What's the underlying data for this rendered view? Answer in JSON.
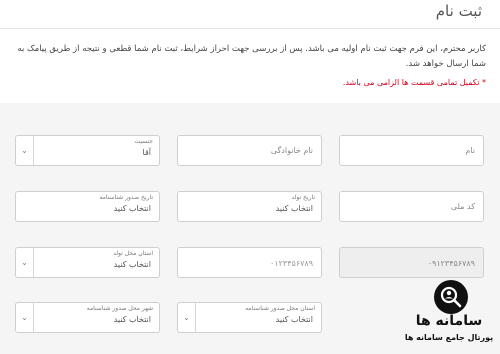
{
  "page": {
    "title": "ثبت نام",
    "intro": "کاربر محترم، این فرم جهت ثبت نام اولیه می باشد. پس از بررسی جهت احراز شرایط، ثبت نام شما قطعی و نتیجه از طریق پیامک به شما ارسال خواهد شد.",
    "required_note": "* تکمیل تمامی قسمت ها الزامی می باشد."
  },
  "form": {
    "first_name": {
      "placeholder": "نام"
    },
    "last_name": {
      "placeholder": "نام خانوادگی"
    },
    "gender": {
      "label": "جنسیت",
      "value": "آقا"
    },
    "national_code": {
      "placeholder": "کد ملی"
    },
    "birth_date": {
      "label": "تاریخ تولد",
      "value": "انتخاب کنید"
    },
    "id_issue_date": {
      "label": "تاریخ صدور شناسنامه",
      "value": "انتخاب کنید"
    },
    "mobile": {
      "value": "۰۹۱۲۳۴۵۶۷۸۹"
    },
    "id_number": {
      "value": "۰۱۲۳۴۵۶۷۸۹"
    },
    "birth_province": {
      "label": "استان محل تولد",
      "value": "انتخاب کنید"
    },
    "id_province": {
      "label": "استان محل صدور شناسنامه",
      "value": "انتخاب کنید"
    },
    "id_city": {
      "label": "شهر محل صدور شناسنامه",
      "value": "انتخاب کنید"
    }
  },
  "watermark": {
    "brand": "سامانه ها",
    "tagline": "پورتال جامع سامانه ها",
    "icon": "magnifier-user-icon"
  }
}
